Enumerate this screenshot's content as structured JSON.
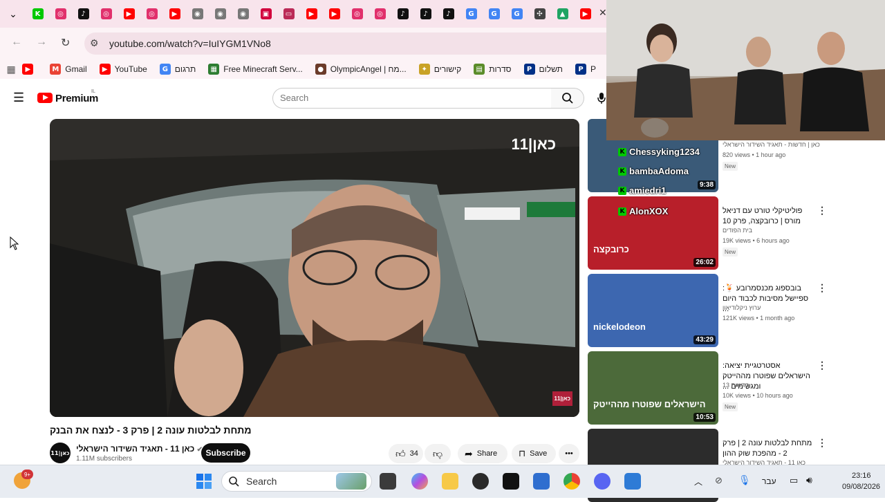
{
  "browser": {
    "url": "youtube.com/watch?v=IuIYGM1VNo8",
    "tabs": [
      {
        "icon": "kick-icon",
        "color": "#00c800",
        "glyph": "K"
      },
      {
        "icon": "instagram-icon",
        "color": "#e1306c",
        "glyph": "◎"
      },
      {
        "icon": "tiktok-icon",
        "color": "#111111",
        "glyph": "♪"
      },
      {
        "icon": "instagram-icon",
        "color": "#e1306c",
        "glyph": "◎"
      },
      {
        "icon": "youtube-icon",
        "color": "#ff0000",
        "glyph": "▶"
      },
      {
        "icon": "instagram-icon",
        "color": "#e1306c",
        "glyph": "◎"
      },
      {
        "icon": "youtube-icon",
        "color": "#ff0000",
        "glyph": "▶"
      },
      {
        "icon": "chrome-icon",
        "color": "#777777",
        "glyph": "◉"
      },
      {
        "icon": "chrome-icon",
        "color": "#777777",
        "glyph": "◉"
      },
      {
        "icon": "chrome-icon",
        "color": "#777777",
        "glyph": "◉"
      },
      {
        "icon": "app-icon",
        "color": "#d1003c",
        "glyph": "▣"
      },
      {
        "icon": "mail-icon",
        "color": "#bb2a57",
        "glyph": "▭"
      },
      {
        "icon": "youtube-icon",
        "color": "#ff0000",
        "glyph": "▶"
      },
      {
        "icon": "youtube-icon",
        "color": "#ff0000",
        "glyph": "▶"
      },
      {
        "icon": "instagram-icon",
        "color": "#e1306c",
        "glyph": "◎"
      },
      {
        "icon": "instagram-icon",
        "color": "#e1306c",
        "glyph": "◎"
      },
      {
        "icon": "tiktok-icon",
        "color": "#111111",
        "glyph": "♪"
      },
      {
        "icon": "tiktok-icon",
        "color": "#111111",
        "glyph": "♪"
      },
      {
        "icon": "tiktok-icon",
        "color": "#111111",
        "glyph": "♪"
      },
      {
        "icon": "google-icon",
        "color": "#4285f4",
        "glyph": "G"
      },
      {
        "icon": "google-icon",
        "color": "#4285f4",
        "glyph": "G"
      },
      {
        "icon": "google-icon",
        "color": "#4285f4",
        "glyph": "G"
      },
      {
        "icon": "openai-icon",
        "color": "#444444",
        "glyph": "✣"
      },
      {
        "icon": "drive-icon",
        "color": "#1fa463",
        "glyph": "▲"
      },
      {
        "icon": "youtube-icon",
        "color": "#ff0000",
        "glyph": "▶"
      }
    ],
    "bookmarks": [
      {
        "label": "",
        "icon": "youtube-icon",
        "color": "#ff0000",
        "glyph": "▶"
      },
      {
        "label": "Gmail",
        "icon": "gmail-icon",
        "color": "#ea4335",
        "glyph": "M"
      },
      {
        "label": "YouTube",
        "icon": "youtube-icon",
        "color": "#ff0000",
        "glyph": "▶"
      },
      {
        "label": "תרגום",
        "icon": "translate-icon",
        "color": "#4285f4",
        "glyph": "G"
      },
      {
        "label": "Free Minecraft Serv...",
        "icon": "minecraft-icon",
        "color": "#2e7d32",
        "glyph": "▦"
      },
      {
        "label": "OlympicAngel | מח...",
        "icon": "avatar-icon",
        "color": "#6b3b2a",
        "glyph": "●"
      },
      {
        "label": "קישורים",
        "icon": "star-icon",
        "color": "#c9a227",
        "glyph": "✦"
      },
      {
        "label": "סדרות",
        "icon": "folder-icon",
        "color": "#5b8c2a",
        "glyph": "▤"
      },
      {
        "label": "תשלום",
        "icon": "paypal-icon",
        "color": "#003087",
        "glyph": "P"
      },
      {
        "label": "P",
        "icon": "paypal-icon",
        "color": "#003087",
        "glyph": "P"
      }
    ]
  },
  "youtube": {
    "logo_text": "Premium",
    "country": "IL",
    "search_placeholder": "Search",
    "video": {
      "title": "מתחת לבלטות עונה 2 | פרק 3 - לנצח את הבנק",
      "channel": "כאן 11 - תאגיד השידור הישראלי",
      "channel_avatar": "כאן|11",
      "subscribers": "1.11M subscribers",
      "subscribe_label": "Subscribe",
      "likes": "34",
      "share_label": "Share",
      "save_label": "Save",
      "watermark": "כאן|11",
      "corner_logo": "כאן|11"
    },
    "related": [
      {
        "title": "",
        "channel": "כאן | חדשות - תאגיד השידור הישראלי",
        "views": "820 views • 1 hour ago",
        "badge": "New",
        "duration": "9:38",
        "thumb_color": "#3a5a78"
      },
      {
        "title": "פוליטיקלי טורט עם דניאל מורס | כרובקצה, פרק 10",
        "channel": "בית הפודים",
        "views": "19K views • 6 hours ago",
        "badge": "New",
        "duration": "26:02",
        "thumb_color": "#b81f2a",
        "thumb_text": "כרובקצה"
      },
      {
        "title": "בובספוג מכנסמרובע 🍹: ספיישל מסיבות לכבוד היום ...",
        "channel": "ערוץ ניקלודיאון",
        "views": "121K views • 1 month ago",
        "badge": "",
        "duration": "43:29",
        "thumb_color": "#3d67b0",
        "thumb_text": "nickelodeon"
      },
      {
        "title": "אסטרטגיית יציאה: הישראלים שפוטרו מההייטק ומגשימים ...",
        "channel": "חדשות 13",
        "views": "10K views • 10 hours ago",
        "badge": "New",
        "duration": "10:53",
        "thumb_color": "#4c6a3a",
        "thumb_text": "הישראלים שפוטרו מההייטק"
      },
      {
        "title": "מתחת לבלטות עונה 2 | פרק 2 - מהפכת שוק ההון",
        "channel": "כאן 11 - תאגיד השידור הישראלי",
        "views": "",
        "badge": "",
        "duration": "",
        "thumb_color": "#2c2c2c",
        "thumb_text": "כאן|11"
      }
    ]
  },
  "stream_overlay": {
    "chat": [
      {
        "user": "Chessyking1234",
        "text": ""
      },
      {
        "user": "bambaAdoma",
        "text": ""
      },
      {
        "user": "amiedri1",
        "text": ""
      },
      {
        "user": "AlonXOX",
        "text": ""
      }
    ]
  },
  "taskbar": {
    "search_label": "Search",
    "weather_badge": "9+",
    "language": "עבר",
    "time": "23:16",
    "date": "09/08/2026"
  }
}
